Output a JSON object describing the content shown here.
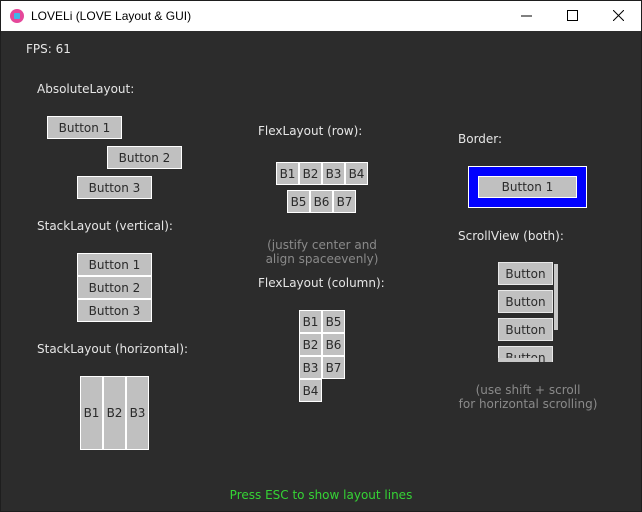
{
  "window": {
    "title": "LOVELi (LOVE Layout & GUI)"
  },
  "fps": "FPS: 61",
  "absolute": {
    "title": "AbsoluteLayout:",
    "buttons": [
      "Button 1",
      "Button 2",
      "Button 3"
    ]
  },
  "stack_vertical": {
    "title": "StackLayout (vertical):",
    "buttons": [
      "Button 1",
      "Button 2",
      "Button 3"
    ]
  },
  "stack_horizontal": {
    "title": "StackLayout (horizontal):",
    "buttons": [
      "B1",
      "B2",
      "B3"
    ]
  },
  "flex_row": {
    "title": "FlexLayout (row):",
    "buttons": [
      "B1",
      "B2",
      "B3",
      "B4",
      "B5",
      "B6",
      "B7"
    ],
    "note": "(justify center and\nalign spaceevenly)"
  },
  "flex_column": {
    "title": "FlexLayout (column):",
    "buttons": [
      "B1",
      "B2",
      "B3",
      "B4",
      "B5",
      "B6",
      "B7"
    ]
  },
  "border": {
    "title": "Border:",
    "button": "Button 1",
    "color": "#0000ff"
  },
  "scroll_view": {
    "title": "ScrollView (both):",
    "buttons": [
      "Button",
      "Button",
      "Button",
      "Button"
    ],
    "note": "(use shift + scroll\nfor horizontal scrolling)"
  },
  "hint": "Press ESC to show layout lines"
}
